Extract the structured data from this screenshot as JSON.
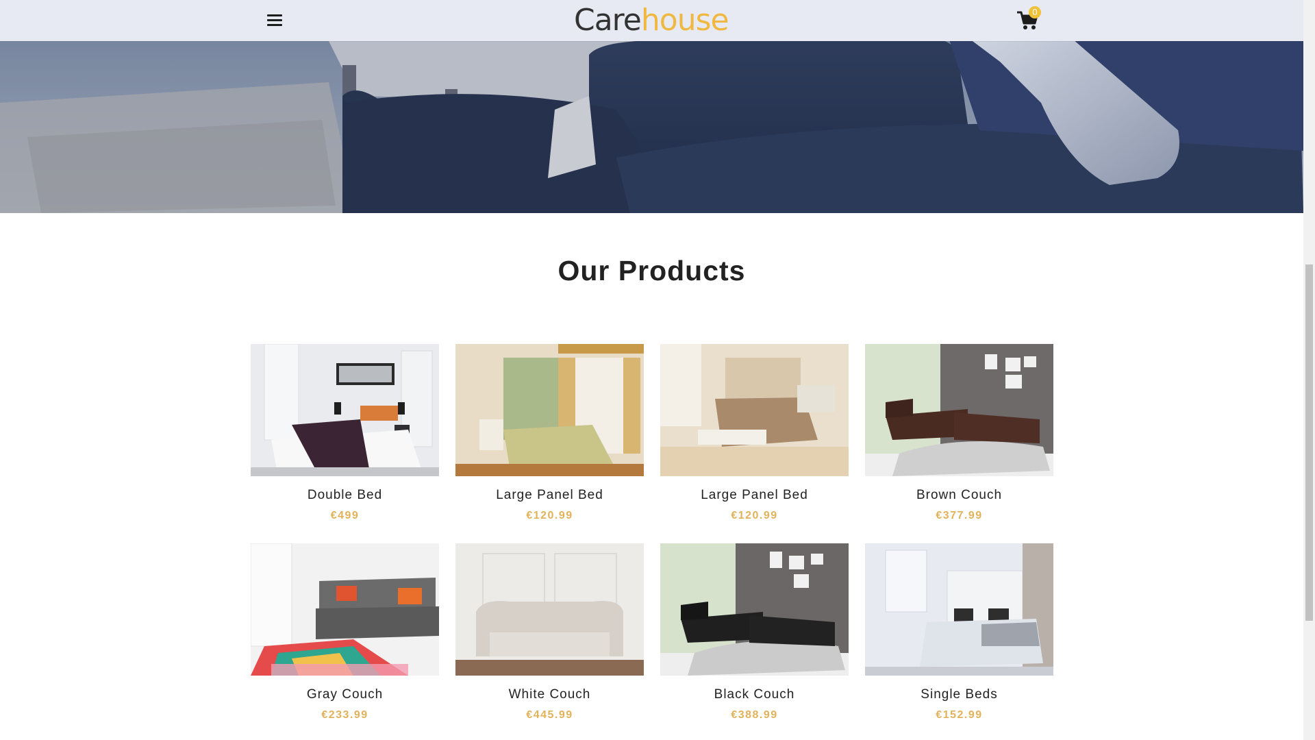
{
  "header": {
    "logo": {
      "part1": "Care",
      "part2": "house"
    },
    "cart_count": "0",
    "menu_icon": "hamburger-menu-icon",
    "cart_icon": "shopping-cart-icon"
  },
  "products_section": {
    "title": "Our Products",
    "items": [
      {
        "name": "Double Bed",
        "price": "€499"
      },
      {
        "name": "Large Panel Bed",
        "price": "€120.99"
      },
      {
        "name": "Large Panel Bed",
        "price": "€120.99"
      },
      {
        "name": "Brown Couch",
        "price": "€377.99"
      },
      {
        "name": "Gray Couch",
        "price": "€233.99"
      },
      {
        "name": "White Couch",
        "price": "€445.99"
      },
      {
        "name": "Black Couch",
        "price": "€388.99"
      },
      {
        "name": "Single Beds",
        "price": "€152.99"
      }
    ]
  },
  "colors": {
    "accent": "#f0b840",
    "price": "#e2b25a",
    "text": "#222222"
  }
}
